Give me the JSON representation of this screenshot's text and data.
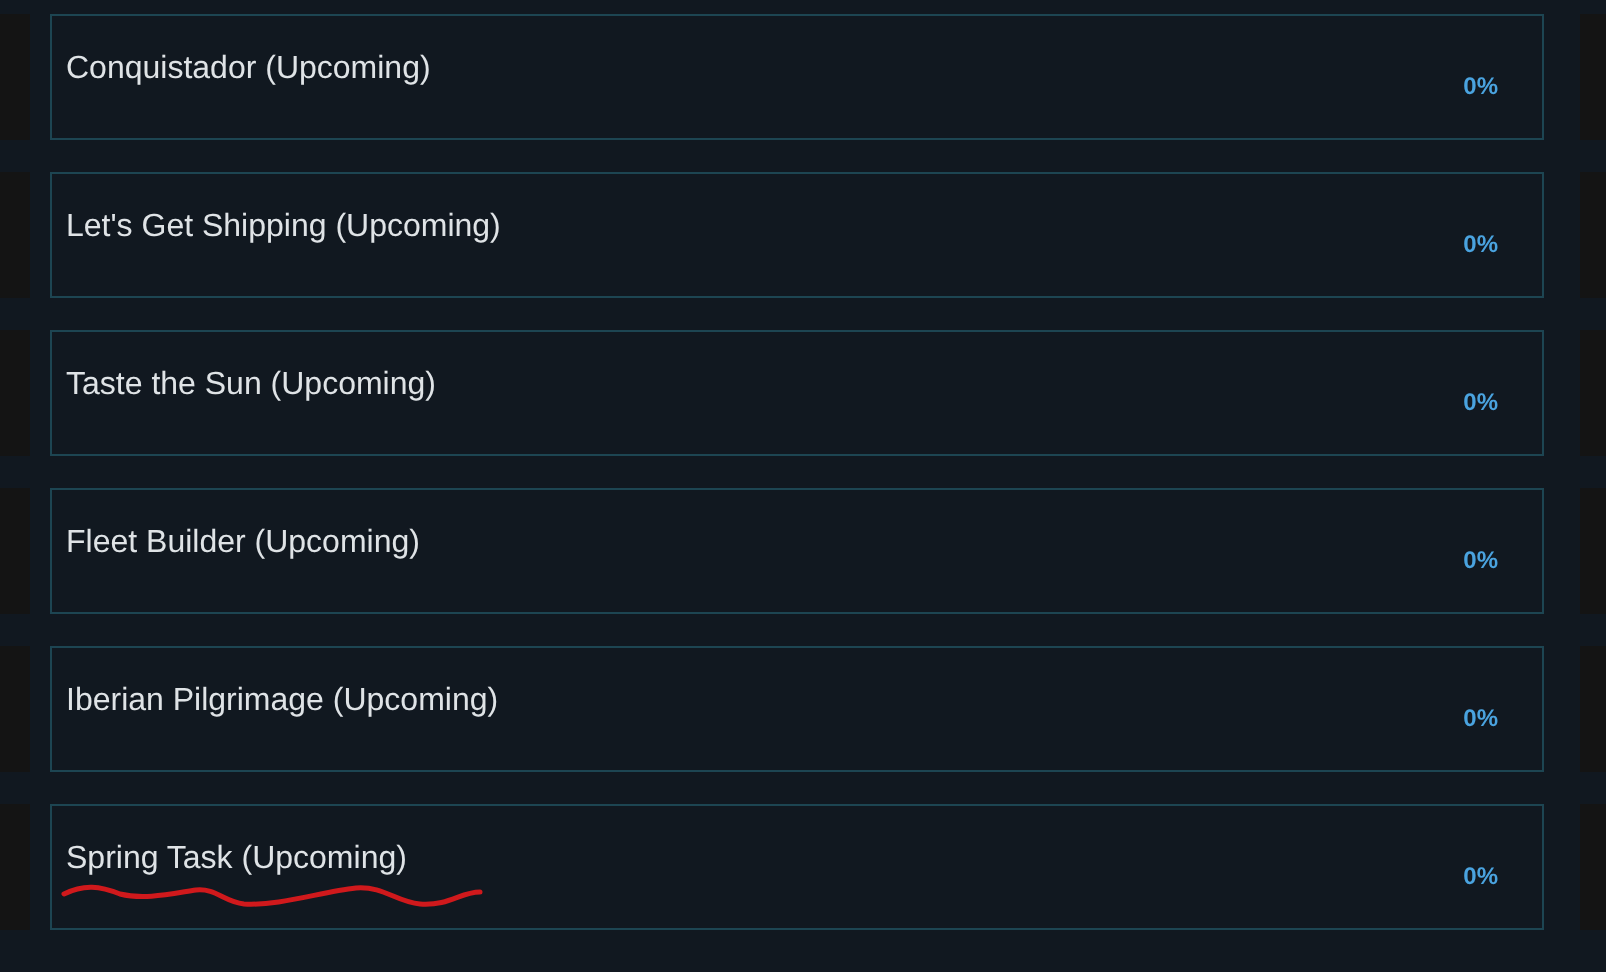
{
  "tasks": [
    {
      "title": "Conquistador (Upcoming)",
      "progress": "0%",
      "underlined": false
    },
    {
      "title": "Let's Get Shipping (Upcoming)",
      "progress": "0%",
      "underlined": false
    },
    {
      "title": "Taste the Sun (Upcoming)",
      "progress": "0%",
      "underlined": false
    },
    {
      "title": "Fleet Builder (Upcoming)",
      "progress": "0%",
      "underlined": false
    },
    {
      "title": "Iberian Pilgrimage (Upcoming)",
      "progress": "0%",
      "underlined": false
    },
    {
      "title": "Spring Task (Upcoming)",
      "progress": "0%",
      "underlined": true
    }
  ]
}
